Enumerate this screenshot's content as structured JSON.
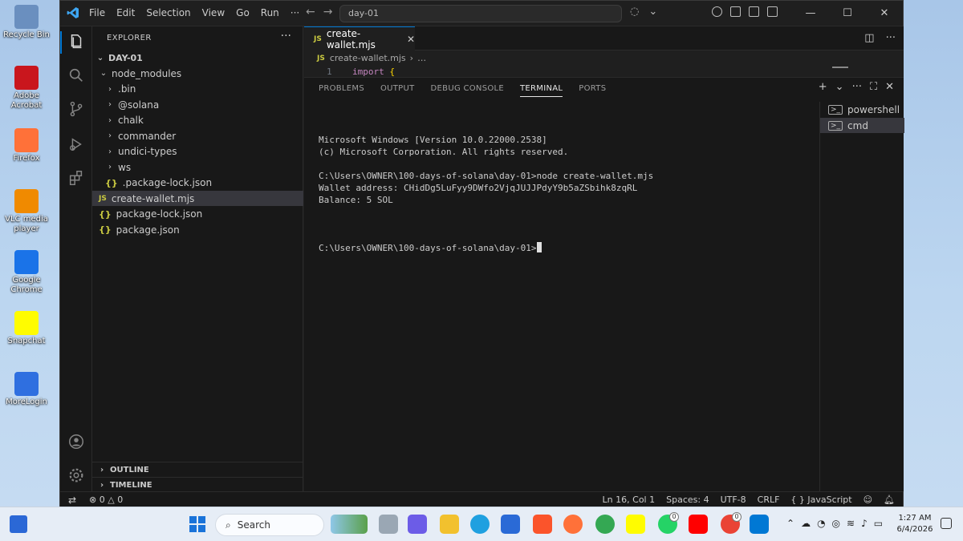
{
  "desktop": {
    "icons": [
      {
        "label": "Recycle Bin",
        "color": "#6a8fbf"
      },
      {
        "label": "Adobe Acrobat",
        "color": "#c9161d"
      },
      {
        "label": "Firefox",
        "color": "#ff7139"
      },
      {
        "label": "VLC media player",
        "color": "#f08a00"
      },
      {
        "label": "Google Chrome",
        "color": "#1a73e8"
      },
      {
        "label": "Snapchat",
        "color": "#fffc00"
      },
      {
        "label": "MoreLogin",
        "color": "#2f6fe0"
      }
    ]
  },
  "titlebar": {
    "menu": [
      "File",
      "Edit",
      "Selection",
      "View",
      "Go",
      "Run",
      "···"
    ],
    "command_center": "day-01"
  },
  "sidebar": {
    "header": "EXPLORER",
    "root": "DAY-01",
    "items": [
      {
        "label": "node_modules",
        "type": "folder-open",
        "indent": 1
      },
      {
        "label": ".bin",
        "type": "folder",
        "indent": 2
      },
      {
        "label": "@solana",
        "type": "folder",
        "indent": 2
      },
      {
        "label": "chalk",
        "type": "folder",
        "indent": 2
      },
      {
        "label": "commander",
        "type": "folder",
        "indent": 2
      },
      {
        "label": "undici-types",
        "type": "folder",
        "indent": 2
      },
      {
        "label": "ws",
        "type": "folder",
        "indent": 2
      },
      {
        "label": ".package-lock.json",
        "type": "json",
        "indent": 2
      },
      {
        "label": "create-wallet.mjs",
        "type": "js",
        "indent": 1,
        "selected": true
      },
      {
        "label": "package-lock.json",
        "type": "json",
        "indent": 1
      },
      {
        "label": "package.json",
        "type": "json",
        "indent": 1
      }
    ],
    "outline": "OUTLINE",
    "timeline": "TIMELINE"
  },
  "editor": {
    "tab_label": "create-wallet.mjs",
    "breadcrumb_file": "create-wallet.mjs",
    "breadcrumb_more": "…",
    "line_number": "1",
    "code_keyword": "import",
    "code_brace": "{"
  },
  "panel": {
    "tabs": [
      "PROBLEMS",
      "OUTPUT",
      "DEBUG CONSOLE",
      "TERMINAL",
      "PORTS"
    ],
    "active_tab": "TERMINAL",
    "terminal_lines": [
      "Microsoft Windows [Version 10.0.22000.2538]",
      "(c) Microsoft Corporation. All rights reserved.",
      "",
      "C:\\Users\\OWNER\\100-days-of-solana\\day-01>node create-wallet.mjs",
      "Wallet address: CHidDg5LuFyy9DWfo2VjqJUJJPdyY9b5aZSbihk8zqRL",
      "Balance: 5 SOL",
      ""
    ],
    "prompt": "C:\\Users\\OWNER\\100-days-of-solana\\day-01>",
    "terminals": [
      {
        "label": "powershell",
        "active": false
      },
      {
        "label": "cmd",
        "active": true
      }
    ]
  },
  "statusbar": {
    "errors": "0",
    "warnings": "0",
    "position": "Ln 16, Col 1",
    "spaces": "Spaces: 4",
    "encoding": "UTF-8",
    "eol": "CRLF",
    "language": "JavaScript"
  },
  "taskbar": {
    "search_label": "Search",
    "time": "1:27 AM",
    "date": "6/4/2026",
    "badge_whatsapp": "0",
    "badge_chrome": "0"
  },
  "colors": {
    "accent": "#0078d4",
    "vscode_bg": "#1f1f1f"
  }
}
